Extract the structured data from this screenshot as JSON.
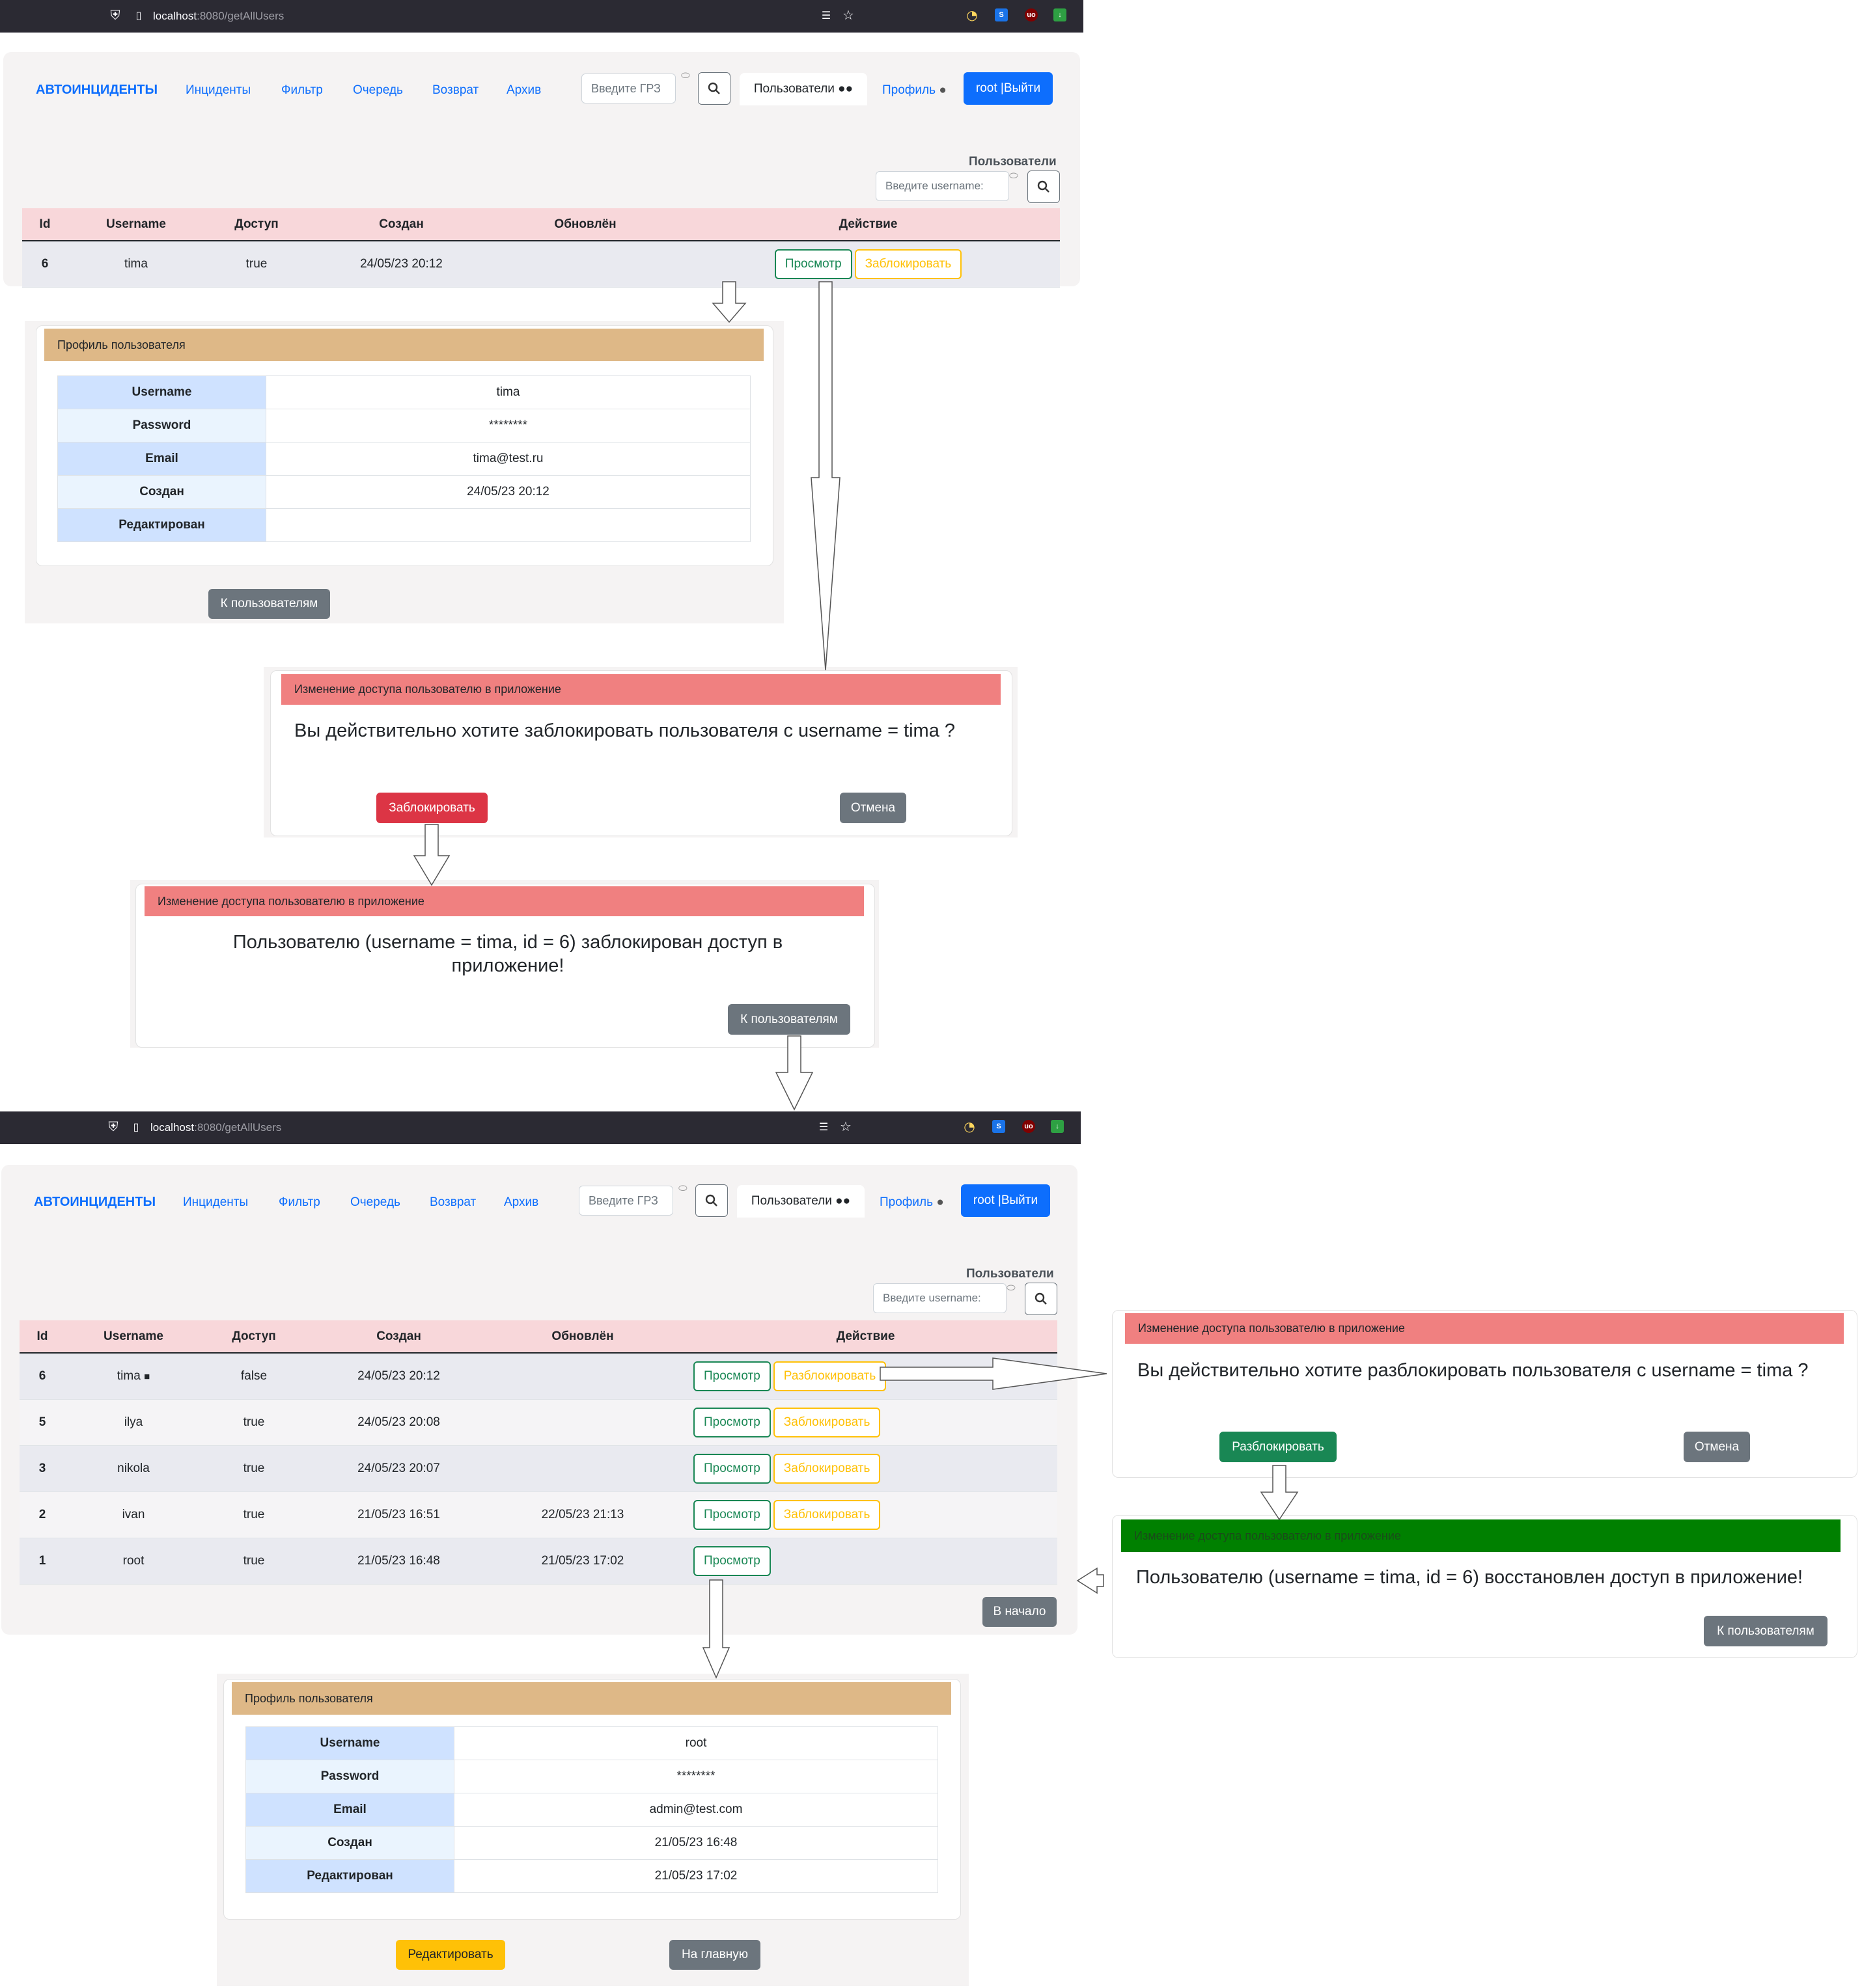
{
  "browser": {
    "url_host": "localhost",
    "url_path": ":8080/getAllUsers",
    "ext_labels": [
      "S",
      "uo"
    ]
  },
  "nav": {
    "brand": "АВТОИНЦИДЕНТЫ",
    "links": [
      "Инциденты",
      "Фильтр",
      "Очередь",
      "Возврат",
      "Архив"
    ],
    "grz_placeholder": "Введите ГРЗ",
    "users_tab": "Пользователи",
    "profile": "Профиль",
    "logout": "root |Выйти"
  },
  "users_page": {
    "title": "Пользователи",
    "search_placeholder": "Введите username:",
    "columns": [
      "Id",
      "Username",
      "Доступ",
      "Создан",
      "Обновлён",
      "Действие"
    ],
    "view_label": "Просмотр",
    "block_label": "Заблокировать",
    "unblock_label": "Разблокировать",
    "home_label": "В начало"
  },
  "table_before": [
    {
      "id": "6",
      "username": "tima",
      "access": "true",
      "created": "24/05/23 20:12",
      "updated": ""
    }
  ],
  "table_after": [
    {
      "id": "6",
      "username": "tima",
      "access": "false",
      "created": "24/05/23 20:12",
      "updated": "",
      "locked": true
    },
    {
      "id": "5",
      "username": "ilya",
      "access": "true",
      "created": "24/05/23 20:08",
      "updated": ""
    },
    {
      "id": "3",
      "username": "nikola",
      "access": "true",
      "created": "24/05/23 20:07",
      "updated": ""
    },
    {
      "id": "2",
      "username": "ivan",
      "access": "true",
      "created": "21/05/23 16:51",
      "updated": "22/05/23 21:13"
    },
    {
      "id": "1",
      "username": "root",
      "access": "true",
      "created": "21/05/23 16:48",
      "updated": "21/05/23 17:02"
    }
  ],
  "profile_tima": {
    "header": "Профиль пользователя",
    "rows": [
      {
        "k": "Username",
        "v": "tima"
      },
      {
        "k": "Password",
        "v": "********"
      },
      {
        "k": "Email",
        "v": "tima@test.ru"
      },
      {
        "k": "Создан",
        "v": "24/05/23 20:12"
      },
      {
        "k": "Редактирован",
        "v": ""
      }
    ],
    "back_label": "К пользователям"
  },
  "profile_root": {
    "header": "Профиль пользователя",
    "rows": [
      {
        "k": "Username",
        "v": "root"
      },
      {
        "k": "Password",
        "v": "********"
      },
      {
        "k": "Email",
        "v": "admin@test.com"
      },
      {
        "k": "Создан",
        "v": "21/05/23 16:48"
      },
      {
        "k": "Редактирован",
        "v": "21/05/23 17:02"
      }
    ],
    "edit_label": "Редактировать",
    "home_label": "На главную"
  },
  "dialogs": {
    "header": "Изменение доступа пользователю в приложение",
    "block_confirm": "Вы действительно хотите заблокировать пользователя с username = tima ?",
    "block_btn": "Заблокировать",
    "cancel_btn": "Отмена",
    "blocked_msg": "Пользователю (username = tima, id = 6) заблокирован доступ в приложение!",
    "back_btn": "К пользователям",
    "unblock_confirm": "Вы действительно хотите разблокировать пользователя с username = tima ?",
    "unblock_btn": "Разблокировать",
    "restored_msg": "Пользователю (username = tima, id = 6) восстановлен доступ в приложение!"
  },
  "colors": {
    "browser_bar": "#2b2a33",
    "primary": "#0d6efd",
    "table_header": "#f8d7da",
    "profile_header": "#deb887",
    "dialog_header_red": "#f08080",
    "dialog_header_green": "#008000",
    "danger": "#dc3545",
    "success": "#198754",
    "secondary": "#6c757d",
    "warning": "#ffc107"
  }
}
